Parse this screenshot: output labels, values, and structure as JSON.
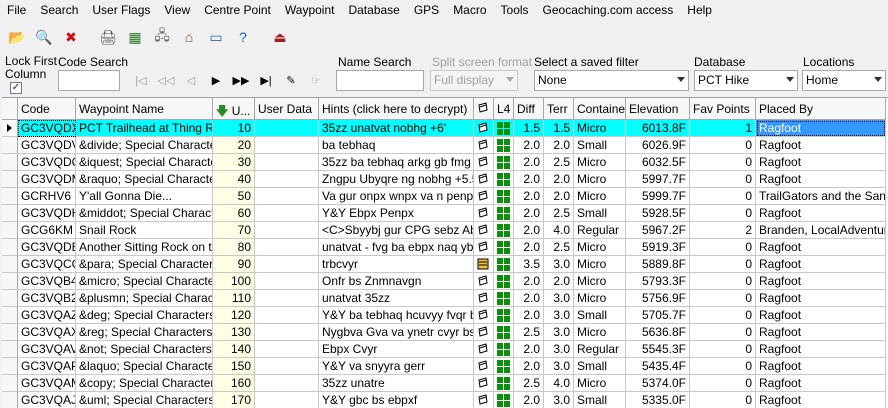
{
  "menu": [
    "File",
    "Search",
    "User Flags",
    "View",
    "Centre Point",
    "Waypoint",
    "Database",
    "GPS",
    "Macro",
    "Tools",
    "Geocaching.com access",
    "Help"
  ],
  "toolbar": {
    "buttons": [
      {
        "name": "open-folder-icon",
        "glyph": "📂"
      },
      {
        "name": "preview-icon",
        "glyph": "🔍"
      },
      {
        "name": "delete-icon",
        "glyph": "✖"
      },
      {
        "name": "print-icon",
        "glyph": "🖨"
      },
      {
        "name": "color-grid-icon",
        "glyph": "▦"
      },
      {
        "name": "network-icon",
        "glyph": "🖧"
      },
      {
        "name": "home-icon",
        "glyph": "⌂"
      },
      {
        "name": "window-icon",
        "glyph": "▭"
      },
      {
        "name": "help-icon",
        "glyph": "?"
      },
      {
        "name": "exit-icon",
        "glyph": "⏏"
      }
    ]
  },
  "filters": {
    "lock_first_column": "Lock First Column",
    "lock_checked": "✓",
    "code_search_label": "Code Search",
    "code_search_value": "",
    "name_search_label": "Name Search",
    "name_search_value": "",
    "split_label": "Split screen format",
    "split_value": "Full display",
    "saved_filter_label": "Select a saved filter",
    "saved_filter_value": "None",
    "database_label": "Database",
    "database_value": "PCT Hike",
    "locations_label": "Locations",
    "locations_value": "Home"
  },
  "grid": {
    "headers": {
      "code": "Code",
      "name": "Waypoint Name",
      "user": "U...",
      "userdata": "User Data",
      "hints": "Hints (click here to decrypt)",
      "l4": "L4",
      "diff": "Diff",
      "terr": "Terr",
      "container": "Container",
      "elevation": "Elevation",
      "fav": "Fav Points",
      "placedby": "Placed By"
    },
    "rows": [
      {
        "code": "GC3VQDX",
        "name": "PCT Trailhead at Thing Road",
        "user": "10",
        "hints": "35zz unatvat nobhg +6'",
        "diff": "1.5",
        "terr": "1.5",
        "container": "Micro",
        "elev": "6013.8F",
        "fav": "1",
        "placed": "Ragfoot",
        "selected": true
      },
      {
        "code": "GC3VQDV",
        "name": "&divide; Special Characters on the PCT",
        "user": "20",
        "hints": "ba tebhaq",
        "diff": "2.0",
        "terr": "2.0",
        "container": "Small",
        "elev": "6026.9F",
        "fav": "0",
        "placed": "Ragfoot"
      },
      {
        "code": "GC3VQDQ",
        "name": "&iquest; Special Characters on the PCT",
        "user": "30",
        "hints": "35zz ba tebhaq arkg gb fmg",
        "diff": "2.0",
        "terr": "2.5",
        "container": "Micro",
        "elev": "6032.5F",
        "fav": "0",
        "placed": "Ragfoot"
      },
      {
        "code": "GC3VQDM",
        "name": "&raquo; Special Characters on the PCT",
        "user": "40",
        "hints": "Zngpu Ubyqre ng nobhg +5.5 sr",
        "diff": "2.0",
        "terr": "2.0",
        "container": "Micro",
        "elev": "5997.7F",
        "fav": "0",
        "placed": "Ragfoot"
      },
      {
        "code": "GCRHV6",
        "name": "Y'all Gonna Die...",
        "user": "50",
        "hints": "Va gur onpx wnpx va n penpx!",
        "diff": "2.0",
        "terr": "2.0",
        "container": "Micro",
        "elev": "5999.7F",
        "fav": "0",
        "placed": "TrailGators and the San Diego"
      },
      {
        "code": "GC3VQDH",
        "name": "&middot; Special Characters on the PCT",
        "user": "60",
        "hints": "Y&Y Ebpx Penpx",
        "diff": "2.0",
        "terr": "2.5",
        "container": "Small",
        "elev": "5928.5F",
        "fav": "0",
        "placed": "Ragfoot"
      },
      {
        "code": "GCG6KM",
        "name": "Snail Rock",
        "user": "70",
        "hints": "<C>Sbyybj gur CPG sebz Abegu",
        "diff": "2.0",
        "terr": "4.0",
        "container": "Regular",
        "elev": "5967.2F",
        "fav": "2",
        "placed": "Branden, LocalAdventures"
      },
      {
        "code": "GC3VQDB",
        "name": "Another Sitting Rock on the PCT",
        "user": "80",
        "hints": "unatvat - fvg ba ebpx naq ybbx",
        "diff": "2.0",
        "terr": "2.5",
        "container": "Micro",
        "elev": "5919.3F",
        "fav": "0",
        "placed": "Ragfoot"
      },
      {
        "code": "GC3VQCG",
        "name": "&para; Special Characters on the PCT",
        "user": "90",
        "hints": "trbcvyr",
        "diff": "3.5",
        "terr": "3.0",
        "container": "Micro",
        "elev": "5889.8F",
        "fav": "0",
        "placed": "Ragfoot",
        "alt_icon": true
      },
      {
        "code": "GC3VQB4",
        "name": "&micro; Special Characters on the PCT",
        "user": "100",
        "hints": "Onfr bs Znmnavgn",
        "diff": "2.0",
        "terr": "2.0",
        "container": "Micro",
        "elev": "5793.3F",
        "fav": "0",
        "placed": "Ragfoot"
      },
      {
        "code": "GC3VQB2",
        "name": "&plusmn; Special Characters on the PCT",
        "user": "110",
        "hints": "unatvat 35zz",
        "diff": "2.0",
        "terr": "3.0",
        "container": "Micro",
        "elev": "5756.9F",
        "fav": "0",
        "placed": "Ragfoot"
      },
      {
        "code": "GC3VQAZ",
        "name": "&deg; Special Characters on the PCT",
        "user": "120",
        "hints": "Y&Y ba tebhaq hcuvyy fvqr bs g",
        "diff": "2.0",
        "terr": "3.0",
        "container": "Small",
        "elev": "5705.7F",
        "fav": "0",
        "placed": "Ragfoot"
      },
      {
        "code": "GC3VQAX",
        "name": "&reg; Special Characters on the PCT",
        "user": "130",
        "hints": "Nygbva Gva va ynetr cvyr bs eb",
        "diff": "2.5",
        "terr": "3.0",
        "container": "Micro",
        "elev": "5636.8F",
        "fav": "0",
        "placed": "Ragfoot"
      },
      {
        "code": "GC3VQAV",
        "name": "&not; Special Characters on the PCT",
        "user": "140",
        "hints": "Ebpx Cvyr",
        "diff": "2.0",
        "terr": "3.0",
        "container": "Regular",
        "elev": "5545.3F",
        "fav": "0",
        "placed": "Ragfoot"
      },
      {
        "code": "GC3VQAP",
        "name": "&laquo; Special Characters on the PCT",
        "user": "150",
        "hints": "Y&Y va snyyra gerr",
        "diff": "2.0",
        "terr": "3.0",
        "container": "Small",
        "elev": "5435.4F",
        "fav": "0",
        "placed": "Ragfoot"
      },
      {
        "code": "GC3VQAM",
        "name": "&copy; Special Characters on the PCT",
        "user": "160",
        "hints": "35zz unatre",
        "diff": "2.5",
        "terr": "4.0",
        "container": "Micro",
        "elev": "5374.0F",
        "fav": "0",
        "placed": "Ragfoot"
      },
      {
        "code": "GC3VQAJ",
        "name": "&uml; Special Characters on the PCT",
        "user": "170",
        "hints": "Y&Y gbc bs ebpxf",
        "diff": "2.0",
        "terr": "3.0",
        "container": "Small",
        "elev": "5335.0F",
        "fav": "0",
        "placed": "Ragfoot"
      }
    ]
  }
}
